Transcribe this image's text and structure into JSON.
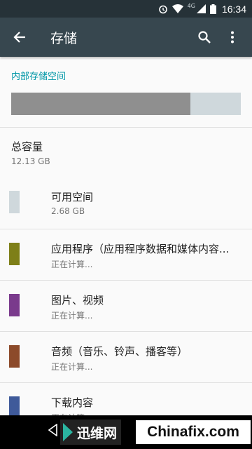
{
  "status_bar": {
    "network": "4G",
    "time": "16:34",
    "icons": [
      "alarm-icon",
      "wifi-icon",
      "signal-icon",
      "battery-icon"
    ]
  },
  "toolbar": {
    "title": "存储",
    "back_icon": "arrow-back-icon",
    "search_icon": "search-icon",
    "menu_icon": "more-vert-icon"
  },
  "storage": {
    "section_title": "内部存储空间",
    "used_fraction": 0.78,
    "colors": {
      "used": "#8f8f8f",
      "free": "#cfd8dc",
      "accent": "#0097a7"
    },
    "total_label": "总容量",
    "total_value": "12.13 GB"
  },
  "categories": [
    {
      "title": "可用空间",
      "subtitle": "2.68 GB",
      "color": "#cfd8dc"
    },
    {
      "title": "应用程序（应用程序数据和媒体内容...",
      "subtitle": "正在计算...",
      "color": "#7e7f18"
    },
    {
      "title": "图片、视频",
      "subtitle": "正在计算...",
      "color": "#7a3a8c"
    },
    {
      "title": "音频（音乐、铃声、播客等）",
      "subtitle": "正在计算...",
      "color": "#8c4a2a"
    },
    {
      "title": "下载内容",
      "subtitle": "正在计算...",
      "color": "#3f5a9a"
    }
  ],
  "watermark": {
    "brand_cn": "迅维网",
    "brand_en": "Chinafix.com"
  }
}
